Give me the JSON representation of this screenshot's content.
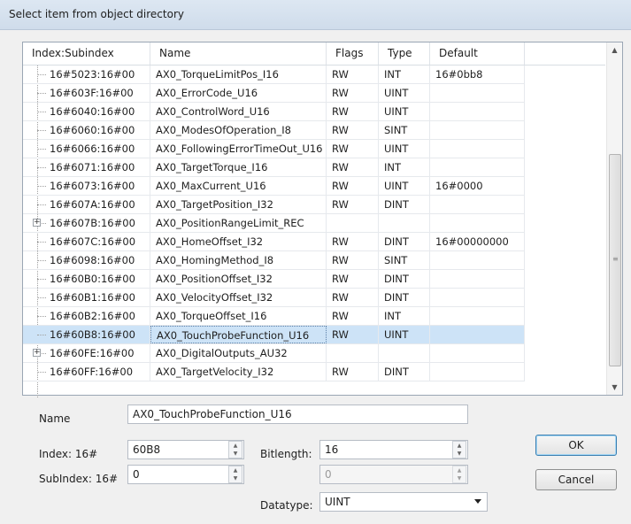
{
  "window": {
    "title": "Select item from object directory"
  },
  "table": {
    "headers": [
      "Index:Subindex",
      "Name",
      "Flags",
      "Type",
      "Default"
    ],
    "rows": [
      {
        "index": "16#5023:16#00",
        "name": "AX0_TorqueLimitPos_I16",
        "flags": "RW",
        "type": "INT",
        "default": "16#0bb8",
        "expander": ""
      },
      {
        "index": "16#603F:16#00",
        "name": "AX0_ErrorCode_U16",
        "flags": "RW",
        "type": "UINT",
        "default": "",
        "expander": ""
      },
      {
        "index": "16#6040:16#00",
        "name": "AX0_ControlWord_U16",
        "flags": "RW",
        "type": "UINT",
        "default": "",
        "expander": ""
      },
      {
        "index": "16#6060:16#00",
        "name": "AX0_ModesOfOperation_I8",
        "flags": "RW",
        "type": "SINT",
        "default": "",
        "expander": ""
      },
      {
        "index": "16#6066:16#00",
        "name": "AX0_FollowingErrorTimeOut_U16",
        "flags": "RW",
        "type": "UINT",
        "default": "",
        "expander": ""
      },
      {
        "index": "16#6071:16#00",
        "name": "AX0_TargetTorque_I16",
        "flags": "RW",
        "type": "INT",
        "default": "",
        "expander": ""
      },
      {
        "index": "16#6073:16#00",
        "name": "AX0_MaxCurrent_U16",
        "flags": "RW",
        "type": "UINT",
        "default": "16#0000",
        "expander": ""
      },
      {
        "index": "16#607A:16#00",
        "name": "AX0_TargetPosition_I32",
        "flags": "RW",
        "type": "DINT",
        "default": "",
        "expander": ""
      },
      {
        "index": "16#607B:16#00",
        "name": "AX0_PositionRangeLimit_REC",
        "flags": "",
        "type": "",
        "default": "",
        "expander": "+"
      },
      {
        "index": "16#607C:16#00",
        "name": "AX0_HomeOffset_I32",
        "flags": "RW",
        "type": "DINT",
        "default": "16#00000000",
        "expander": ""
      },
      {
        "index": "16#6098:16#00",
        "name": "AX0_HomingMethod_I8",
        "flags": "RW",
        "type": "SINT",
        "default": "",
        "expander": ""
      },
      {
        "index": "16#60B0:16#00",
        "name": "AX0_PositionOffset_I32",
        "flags": "RW",
        "type": "DINT",
        "default": "",
        "expander": ""
      },
      {
        "index": "16#60B1:16#00",
        "name": "AX0_VelocityOffset_I32",
        "flags": "RW",
        "type": "DINT",
        "default": "",
        "expander": ""
      },
      {
        "index": "16#60B2:16#00",
        "name": "AX0_TorqueOffset_I16",
        "flags": "RW",
        "type": "INT",
        "default": "",
        "expander": ""
      },
      {
        "index": "16#60B8:16#00",
        "name": "AX0_TouchProbeFunction_U16",
        "flags": "RW",
        "type": "UINT",
        "default": "",
        "expander": ""
      },
      {
        "index": "16#60FE:16#00",
        "name": "AX0_DigitalOutputs_AU32",
        "flags": "",
        "type": "",
        "default": "",
        "expander": "+"
      },
      {
        "index": "16#60FF:16#00",
        "name": "AX0_TargetVelocity_I32",
        "flags": "RW",
        "type": "DINT",
        "default": "",
        "expander": ""
      }
    ],
    "selected_index": 14
  },
  "form": {
    "name_label": "Name",
    "name_value": "AX0_TouchProbeFunction_U16",
    "index_label": "Index: 16#",
    "index_value": "60B8",
    "bitlength_label": "Bitlength:",
    "bitlength_value": "16",
    "subindex_label": "SubIndex: 16#",
    "subindex_value": "0",
    "subindex_right_value": "0",
    "datatype_label": "Datatype:",
    "datatype_value": "UINT"
  },
  "buttons": {
    "ok": "OK",
    "cancel": "Cancel"
  },
  "colors": {
    "selection": "#cde3f7",
    "titlebar": "#d6e2ef",
    "default_button_border": "#3c7fb1"
  }
}
